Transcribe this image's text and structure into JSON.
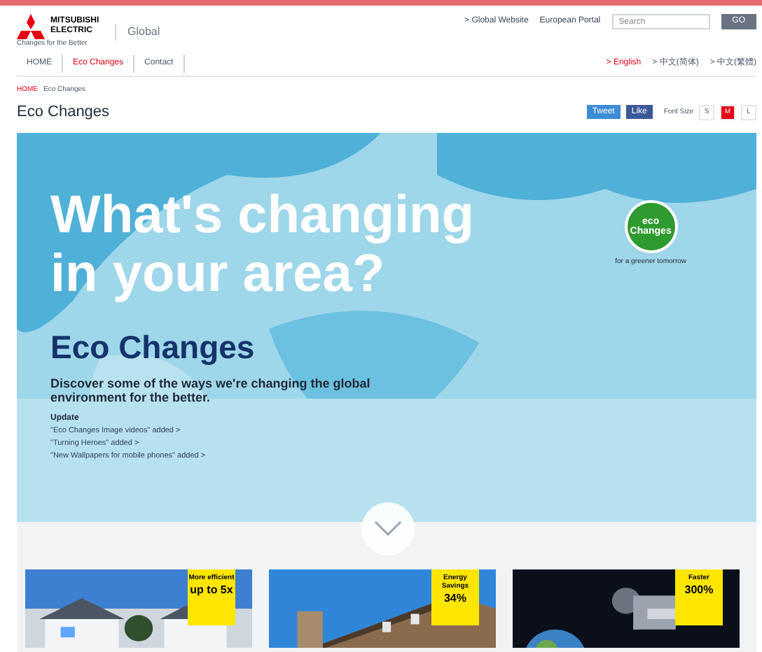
{
  "header": {
    "logo_name": "MITSUBISHI ELECTRIC",
    "tagline": "Changes for the Better",
    "site": "Global",
    "links": [
      "> Global Website",
      "European Portal"
    ],
    "search": {
      "placeholder": "Search",
      "button": "GO"
    }
  },
  "nav": [
    {
      "label": "HOME",
      "selected": false
    },
    {
      "label": "Eco Changes",
      "selected": true
    },
    {
      "label": "Contact",
      "selected": false
    }
  ],
  "languages": [
    {
      "label": "> English",
      "selected": true
    },
    {
      "label": "> 中文(简体)",
      "selected": false
    },
    {
      "label": "> 中文(繁體)",
      "selected": false
    }
  ],
  "breadcrumb": [
    "HOME",
    "Eco Changes"
  ],
  "page_title": "Eco Changes",
  "share": [
    {
      "label": "Tweet",
      "kind": "twitter"
    },
    {
      "label": "Like",
      "kind": "facebook"
    }
  ],
  "font_size": {
    "label": "Font Size",
    "options": [
      {
        "label": "S",
        "selected": false
      },
      {
        "label": "M",
        "selected": true
      },
      {
        "label": "L",
        "selected": false
      }
    ]
  },
  "hero": {
    "headline": [
      "What's changing",
      "in your area?"
    ],
    "badge": {
      "logo": "eco Changes",
      "caption": "for a greener tomorrow"
    },
    "title": "Eco Changes",
    "description": "Discover some of the ways we're changing the global environment for the better.",
    "update_label": "Update",
    "updates": [
      "\"Eco Changes Image videos\" added >",
      "\"Turning Heroes\" added >",
      "\"New Wallpapers for mobile phones\" added >"
    ]
  },
  "cards": [
    {
      "badge": [
        "More efficient"
      ],
      "value": "up to 5x"
    },
    {
      "badge": [
        "Energy Savings"
      ],
      "value": "34%"
    },
    {
      "badge": [
        "Faster"
      ],
      "value": "300%"
    }
  ]
}
